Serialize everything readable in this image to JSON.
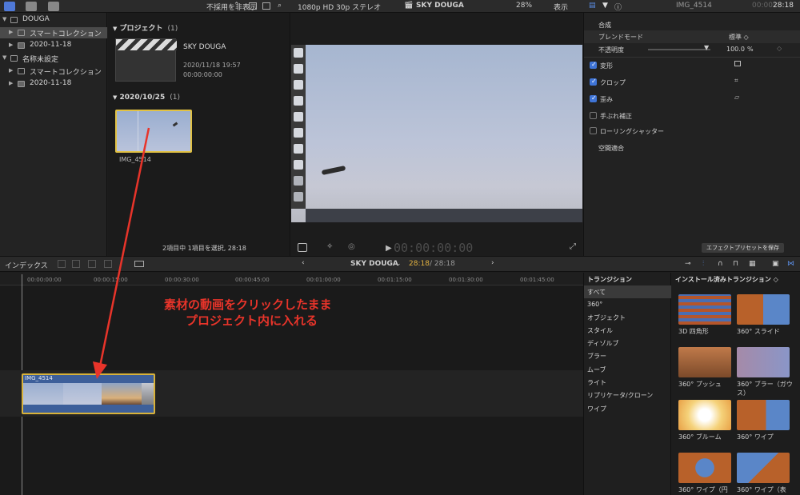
{
  "toolbar": {
    "filter_label": "不採用を非表示",
    "viewer_format": "1080p HD 30p ステレオ",
    "viewer_project": "SKY DOUGA",
    "zoom": "28%",
    "view_menu": "表示",
    "inspector_clip_name": "IMG_4514",
    "inspector_timecode_dim": "00:00:",
    "inspector_timecode": "28:18"
  },
  "libraries": [
    {
      "label": "DOUGA",
      "level": 0,
      "icon": "library-icon",
      "selected": false
    },
    {
      "label": "スマートコレクション",
      "level": 1,
      "icon": "folder-icon",
      "selected": true
    },
    {
      "label": "2020-11-18",
      "level": 1,
      "icon": "event-icon",
      "selected": false
    },
    {
      "label": "名称未設定",
      "level": 0,
      "icon": "library-icon",
      "selected": false
    },
    {
      "label": "スマートコレクション",
      "level": 1,
      "icon": "folder-icon",
      "selected": false
    },
    {
      "label": "2020-11-18",
      "level": 1,
      "icon": "event-icon",
      "selected": false
    }
  ],
  "browser": {
    "section_project": "プロジェクト",
    "section_project_count": "(1)",
    "project_name": "SKY DOUGA",
    "project_date": "2020/11/18 19:57",
    "project_duration": "00:00:00:00",
    "section_date": "2020/10/25",
    "section_date_count": "(1)",
    "clip_name": "IMG_4514",
    "status": "2項目中 1項目を選択, 28:18"
  },
  "viewer": {
    "timecode": "00:00:00:00"
  },
  "inspector": {
    "compositing": "合成",
    "blend_mode_label": "ブレンドモード",
    "blend_mode_value": "標準 ◇",
    "opacity_label": "不透明度",
    "opacity_value": "100.0",
    "opacity_unit": "%",
    "options": [
      {
        "label": "変形",
        "checked": true
      },
      {
        "label": "クロップ",
        "checked": true
      },
      {
        "label": "歪み",
        "checked": true
      },
      {
        "label": "手ぶれ補正",
        "checked": false
      },
      {
        "label": "ローリングシャッター",
        "checked": false
      }
    ],
    "spatial": "空間適合",
    "save_preset": "エフェクトプリセットを保存"
  },
  "timeline_bar": {
    "index_label": "インデックス",
    "project": "SKY DOUGA",
    "time_current": "28:18",
    "time_total": "/ 28:18"
  },
  "ruler_ticks": [
    "00:00:00:00",
    "00:00:15:00",
    "00:00:30:00",
    "00:00:45:00",
    "00:01:00:00",
    "00:01:15:00",
    "00:01:30:00",
    "00:01:45:00"
  ],
  "timeline_clip": "IMG_4514",
  "annotation": {
    "line1": "素材の動画をクリックしたまま",
    "line2": "プロジェクト内に入れる"
  },
  "transitions": {
    "header": "トランジション",
    "grid_header": "インストール済みトランジション ◇",
    "categories": [
      "すべて",
      "360°",
      "オブジェクト",
      "スタイル",
      "ディゾルブ",
      "ブラー",
      "ムーブ",
      "ライト",
      "リプリケータ/クローン",
      "ワイプ"
    ],
    "items": [
      "3D 四角形",
      "360° スライド",
      "360° プッシュ",
      "360° ブラー（ガウス）",
      "360° ブルーム",
      "360° ワイプ",
      "360° ワイプ（円",
      "360° ワイプ（表"
    ]
  },
  "colors": {
    "accent_blue": "#3f74d6",
    "annotation_red": "#e8342a",
    "clip_border": "#d8b23a",
    "timecode_yellow": "#e3b341"
  }
}
